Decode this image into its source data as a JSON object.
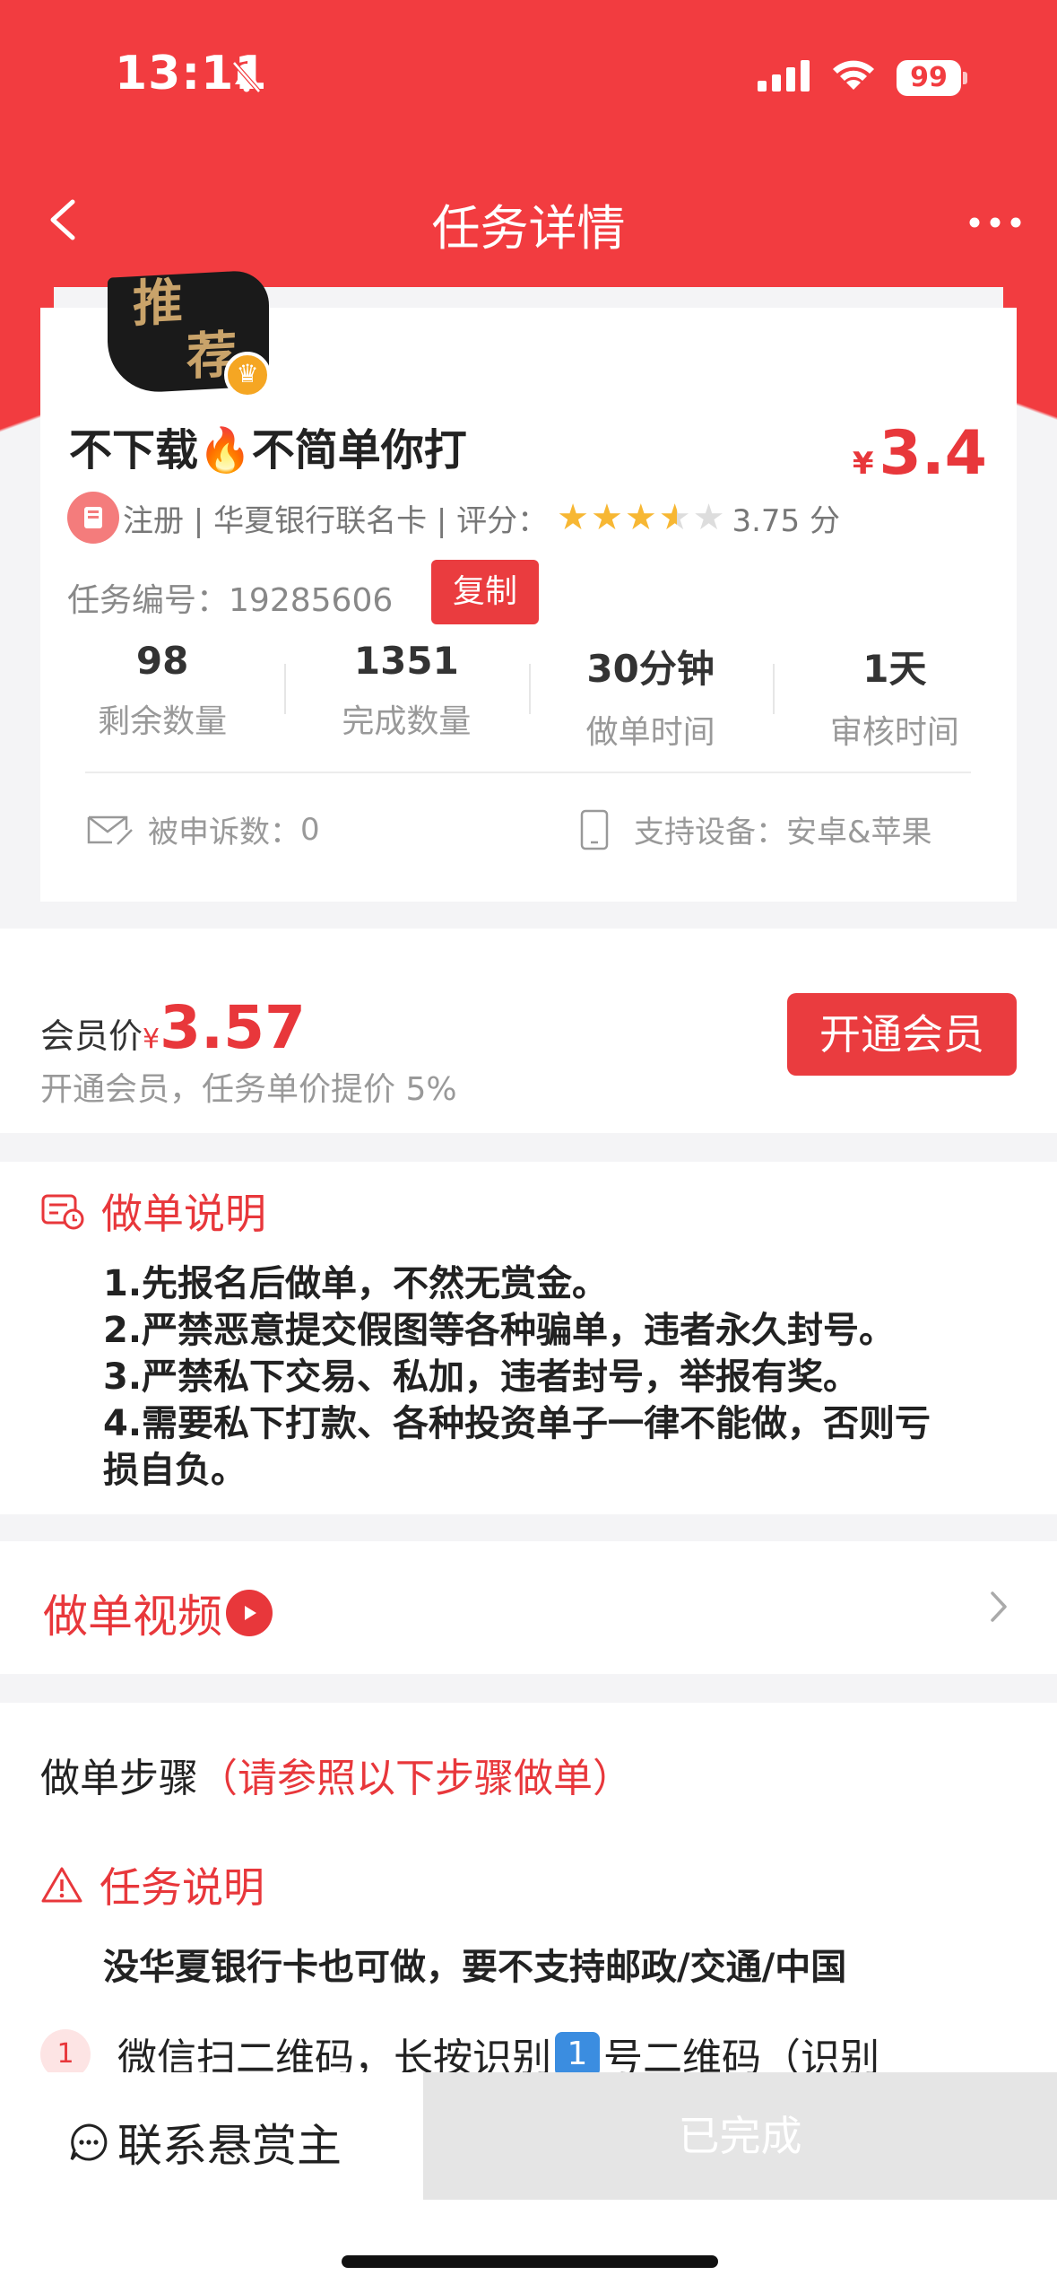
{
  "status_bar": {
    "time": "13:11",
    "battery": "99"
  },
  "nav": {
    "title": "任务详情"
  },
  "badge": {
    "text1": "推",
    "text2": "荐"
  },
  "task": {
    "title": "不下载🔥不简单你打",
    "price_symbol": "¥",
    "price": "3.4",
    "tag_text": "注册 | 华夏银行联名卡 | 评分：",
    "rating_text": "3.75 分",
    "rating": 3.75,
    "task_no_label": "任务编号：",
    "task_no": "19285606",
    "copy_label": "复制"
  },
  "stats": [
    {
      "num": "98",
      "label": "剩余数量"
    },
    {
      "num": "1351",
      "label": "完成数量"
    },
    {
      "num": "30分钟",
      "label": "做单时间"
    },
    {
      "num": "1天",
      "label": "审核时间"
    }
  ],
  "complaint_label": "被申诉数：",
  "complaint_value": "0",
  "device_label": "支持设备：",
  "device_value": "安卓&苹果",
  "member": {
    "label": "会员价",
    "symbol": "¥",
    "price": "3.57",
    "desc": "开通会员，任务单价提价 5%",
    "button": "开通会员"
  },
  "notes": {
    "title": "做单说明",
    "lines": [
      "1.先报名后做单，不然无赏金。",
      "2.严禁恶意提交假图等各种骗单，违者永久封号。",
      "3.严禁私下交易、私加，违者封号，举报有奖。",
      "4.需要私下打款、各种投资单子一律不能做，否则亏损自负。"
    ]
  },
  "video": {
    "label": "做单视频"
  },
  "steps": {
    "title": "做单步骤",
    "hint": "（请参照以下步骤做单）",
    "task_note_title": "任务说明",
    "task_note_text": "没华夏银行卡也可做，要不支持邮政/交通/中国",
    "step1_num": "1",
    "step1_text_a": "微信扫二维码，长按识别",
    "step1_key": "1",
    "step1_text_b": "号二维码（识别"
  },
  "bottom": {
    "contact": "联系悬赏主",
    "done": "已完成"
  },
  "colors": {
    "accent": "#f23c40",
    "star": "#f7b733"
  }
}
